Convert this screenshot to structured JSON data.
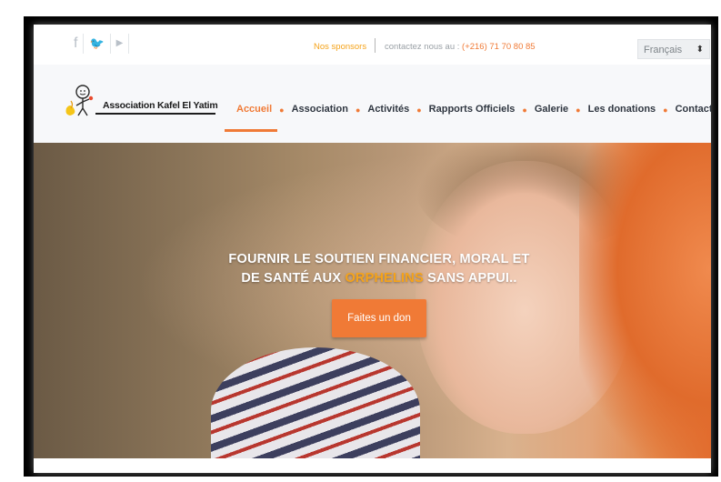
{
  "topbar": {
    "social_icons": [
      "facebook-icon",
      "twitter-icon",
      "youtube-icon"
    ],
    "social_glyphs": [
      "f",
      "🐦",
      "▶"
    ],
    "sponsors_link": "Nos sponsors",
    "contact_prefix": "contactez nous au : ",
    "contact_phone": "(+216) 71 70 80 85",
    "language": "Français"
  },
  "brand": {
    "name": "Association Kafel El Yatim"
  },
  "nav": {
    "items": [
      {
        "label": "Accueil",
        "active": true
      },
      {
        "label": "Association",
        "active": false
      },
      {
        "label": "Activités",
        "active": false
      },
      {
        "label": "Rapports Officiels",
        "active": false
      },
      {
        "label": "Galerie",
        "active": false
      },
      {
        "label": "Les donations",
        "active": false
      },
      {
        "label": "Contact",
        "active": false
      }
    ]
  },
  "hero": {
    "line1": "FOURNIR LE SOUTIEN FINANCIER, MORAL ET",
    "line2_prefix": "DE SANTÉ AUX ",
    "line2_highlight": "ORPHELINS",
    "line2_suffix": " SANS APPUI..",
    "cta": "Faites un don"
  },
  "colors": {
    "accent": "#f07a36",
    "highlight": "#f5a31a",
    "nav_text": "#2f3640"
  }
}
